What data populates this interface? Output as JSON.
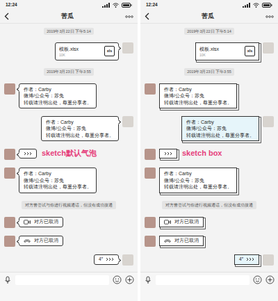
{
  "phones": [
    {
      "status_time": "12:24",
      "title": "苦瓜",
      "label": "sketch默认气泡",
      "bubble_kind": "default",
      "messages": [
        {
          "kind": "time",
          "text": "2019年3月22日 下午5:14"
        },
        {
          "kind": "file",
          "side": "right",
          "name": "模板.xlsx",
          "size": "10K",
          "badge": "xls"
        },
        {
          "kind": "time",
          "text": "2019年3月23日 下午3:55"
        },
        {
          "kind": "text",
          "side": "left",
          "lines": [
            "作者：Carby",
            "微博/公众号：苏兔",
            "转载请注明出处，尊重分享者。"
          ]
        },
        {
          "kind": "text",
          "side": "right",
          "lines": [
            "作者：Carby",
            "微博/公众号：苏兔",
            "转载请注明出处，尊重分享者。"
          ]
        },
        {
          "kind": "voice",
          "side": "left"
        },
        {
          "kind": "text",
          "side": "left",
          "lines": [
            "作者：Carby",
            "微博/公众号：苏兔",
            "转载请注明出处，尊重分享者。"
          ]
        },
        {
          "kind": "system",
          "text": "对方曾尝试与你进行视频通话，但没有成功接通"
        },
        {
          "kind": "call",
          "side": "left",
          "call_type": "video",
          "text": "对方已取消"
        },
        {
          "kind": "call",
          "side": "left",
          "call_type": "voice",
          "text": "对方已取消"
        },
        {
          "kind": "voice",
          "side": "right",
          "duration": "4″"
        }
      ]
    },
    {
      "status_time": "12:24",
      "title": "苦瓜",
      "label": "sketch box",
      "bubble_kind": "box",
      "messages": [
        {
          "kind": "time",
          "text": "2019年3月22日 下午5:14"
        },
        {
          "kind": "file",
          "side": "right",
          "name": "模板.xlsx",
          "size": "10K",
          "badge": "xls"
        },
        {
          "kind": "time",
          "text": "2019年3月23日 下午3:55"
        },
        {
          "kind": "text",
          "side": "left",
          "lines": [
            "作者：Carby",
            "微博/公众号：苏兔",
            "转载请注明出处，尊重分享者。"
          ]
        },
        {
          "kind": "text",
          "side": "right",
          "lines": [
            "作者：Carby",
            "微博/公众号：苏兔",
            "转载请注明出处，尊重分享者。"
          ]
        },
        {
          "kind": "voice",
          "side": "left"
        },
        {
          "kind": "text",
          "side": "left",
          "lines": [
            "作者：Carby",
            "微博/公众号：苏兔",
            "转载请注明出处，尊重分享者。"
          ]
        },
        {
          "kind": "system",
          "text": "对方曾尝试与你进行视频通话，但没有成功接通"
        },
        {
          "kind": "call",
          "side": "left",
          "call_type": "video",
          "text": "对方已取消"
        },
        {
          "kind": "call",
          "side": "left",
          "call_type": "voice",
          "text": "对方已取消"
        },
        {
          "kind": "voice",
          "side": "right",
          "duration": "4″"
        }
      ]
    }
  ]
}
